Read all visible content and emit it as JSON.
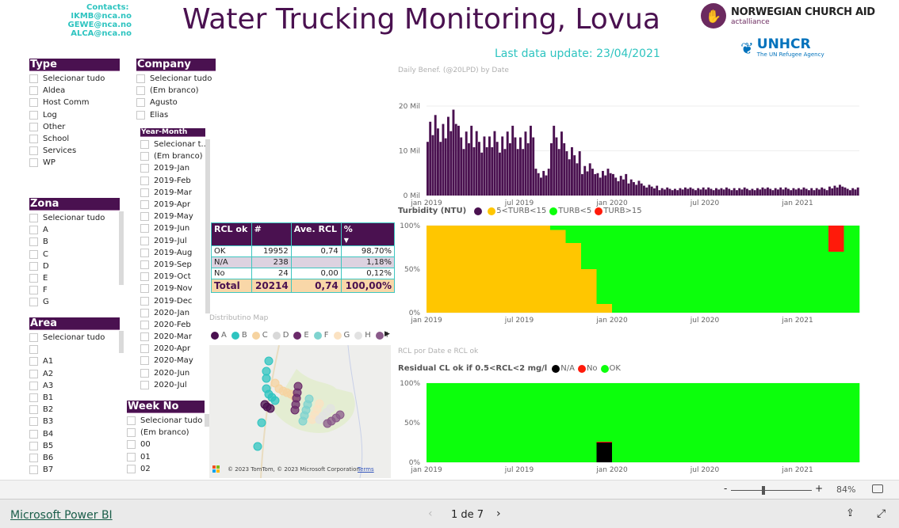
{
  "header": {
    "contacts_label": "Contacts:",
    "contacts": [
      "IKMB@nca.no",
      "GEWE@nca.no",
      "ALCA@nca.no"
    ],
    "title": "Water Trucking Monitoring, Lovua",
    "last_update": "Last data update: 23/04/2021",
    "logo_nca": "NORWEGIAN CHURCH AID",
    "logo_nca_sub": "actalliance",
    "logo_unhcr": "UNHCR",
    "logo_unhcr_sub": "The UN Refugee Agency"
  },
  "slicers": {
    "type": {
      "title": "Type",
      "items": [
        "Selecionar tudo",
        "Aldea",
        "Host Comm",
        "Log",
        "Other",
        "School",
        "Services",
        "WP"
      ]
    },
    "company": {
      "title": "Company",
      "items": [
        "Selecionar tudo",
        "(Em branco)",
        "Agusto",
        "Elias"
      ]
    },
    "year_month": {
      "title": "Year-Month",
      "items": [
        "Selecionar t...",
        "(Em branco)",
        "2019-Jan",
        "2019-Feb",
        "2019-Mar",
        "2019-Apr",
        "2019-May",
        "2019-Jun",
        "2019-Jul",
        "2019-Aug",
        "2019-Sep",
        "2019-Oct",
        "2019-Nov",
        "2019-Dec",
        "2020-Jan",
        "2020-Feb",
        "2020-Mar",
        "2020-Apr",
        "2020-May",
        "2020-Jun",
        "2020-Jul"
      ]
    },
    "zona": {
      "title": "Zona",
      "items": [
        "Selecionar tudo",
        "A",
        "B",
        "C",
        "D",
        "E",
        "F",
        "G"
      ]
    },
    "area": {
      "title": "Area",
      "items": [
        "Selecionar tudo",
        "",
        "A1",
        "A2",
        "A3",
        "B1",
        "B2",
        "B3",
        "B4",
        "B5",
        "B6",
        "B7"
      ]
    },
    "week": {
      "title": "Week No",
      "items": [
        "Selecionar tudo",
        "(Em branco)",
        "00",
        "01",
        "02"
      ]
    }
  },
  "rcl_table": {
    "headers": [
      "RCL ok",
      "#",
      "Ave. RCL",
      "%"
    ],
    "rows": [
      [
        "OK",
        "19952",
        "0,74",
        "98,70%"
      ],
      [
        "N/A",
        "238",
        "",
        "1,18%"
      ],
      [
        "No",
        "24",
        "0,00",
        "0,12%"
      ]
    ],
    "total": [
      "Total",
      "20214",
      "0,74",
      "100,00%"
    ]
  },
  "map": {
    "title": "Distributino Map",
    "legend": [
      {
        "label": "A",
        "color": "#4a1150"
      },
      {
        "label": "B",
        "color": "#2ec4c0"
      },
      {
        "label": "C",
        "color": "#f6d3a0"
      },
      {
        "label": "D",
        "color": "#d8d8d8"
      },
      {
        "label": "E",
        "color": "#6b2a6a"
      },
      {
        "label": "F",
        "color": "#7fd3cf"
      },
      {
        "label": "G",
        "color": "#fbe2c2"
      },
      {
        "label": "H",
        "color": "#e2e2e2"
      },
      {
        "label": "I",
        "color": "#8a5a8a"
      }
    ],
    "attribution": "© 2023 TomTom, © 2023 Microsoft Corporation",
    "terms": "Terms"
  },
  "chart_data": [
    {
      "type": "bar",
      "title": "Daily Benef. (@20LPD) by Date",
      "ylabel": "",
      "yticks": [
        "0 Mil",
        "10 Mil",
        "20 Mil"
      ],
      "ylim": [
        0,
        25
      ],
      "unit": "Mil",
      "xticks": [
        "jan 2019",
        "jul 2019",
        "jan 2020",
        "jul 2020",
        "jan 2021"
      ],
      "color": "#4a1150",
      "categories": [
        "2019-01",
        "2019-02",
        "2019-03",
        "2019-04",
        "2019-05",
        "2019-06",
        "2019-07",
        "2019-08",
        "2019-09",
        "2019-10",
        "2019-11",
        "2019-12",
        "2020-01",
        "2020-02",
        "2020-03",
        "2020-04",
        "2020-05",
        "2020-06",
        "2020-07",
        "2020-08",
        "2020-09",
        "2020-10",
        "2020-11",
        "2020-12",
        "2021-01",
        "2021-02",
        "2021-03",
        "2021-04"
      ],
      "values": [
        15,
        16,
        13,
        12,
        12,
        13,
        13,
        5,
        13,
        9,
        6,
        5,
        4,
        3,
        2,
        1.5,
        1.5,
        1.5,
        1.5,
        1.5,
        1.5,
        1.5,
        1.5,
        1.5,
        1.5,
        1.5,
        2,
        1.5
      ]
    },
    {
      "type": "bar",
      "stacked": "percent",
      "title": "Turbidity (NTU)",
      "yticks": [
        "0%",
        "50%",
        "100%"
      ],
      "xticks": [
        "jan 2019",
        "jul 2019",
        "jan 2020",
        "jul 2020",
        "jan 2021"
      ],
      "categories": [
        "2019-01",
        "2019-02",
        "2019-03",
        "2019-04",
        "2019-05",
        "2019-06",
        "2019-07",
        "2019-08",
        "2019-09",
        "2019-10",
        "2019-11",
        "2019-12",
        "2020-01",
        "2020-02",
        "2020-03",
        "2020-04",
        "2020-05",
        "2020-06",
        "2020-07",
        "2020-08",
        "2020-09",
        "2020-10",
        "2020-11",
        "2020-12",
        "2021-01",
        "2021-02",
        "2021-03",
        "2021-04"
      ],
      "series": [
        {
          "name": "5<TURB<15",
          "color": "#ffc600",
          "values": [
            100,
            100,
            100,
            100,
            100,
            100,
            100,
            100,
            95,
            80,
            50,
            10,
            0,
            0,
            0,
            0,
            0,
            0,
            0,
            0,
            0,
            0,
            0,
            0,
            0,
            0,
            0,
            0
          ]
        },
        {
          "name": "TURB<5",
          "color": "#0cff0c",
          "values": [
            0,
            0,
            0,
            0,
            0,
            0,
            0,
            0,
            5,
            20,
            50,
            90,
            100,
            100,
            100,
            100,
            100,
            100,
            100,
            100,
            100,
            100,
            100,
            100,
            100,
            100,
            70,
            100
          ]
        },
        {
          "name": "TURB>15",
          "color": "#ff1a0a",
          "values": [
            0,
            0,
            0,
            0,
            0,
            0,
            0,
            0,
            0,
            0,
            0,
            0,
            0,
            0,
            0,
            0,
            0,
            0,
            0,
            0,
            0,
            0,
            0,
            0,
            0,
            0,
            30,
            0
          ]
        }
      ],
      "legend_extra_color": "#4a1150"
    },
    {
      "type": "bar",
      "stacked": "percent",
      "title": "RCL por Date e RCL ok",
      "legend_title": "Residual CL ok if 0.5<RCL<2 mg/l",
      "yticks": [
        "0%",
        "50%",
        "100%"
      ],
      "xticks": [
        "jan 2019",
        "jul 2019",
        "jan 2020",
        "jul 2020",
        "jan 2021"
      ],
      "categories": [
        "2019-01",
        "2019-02",
        "2019-03",
        "2019-04",
        "2019-05",
        "2019-06",
        "2019-07",
        "2019-08",
        "2019-09",
        "2019-10",
        "2019-11",
        "2019-12",
        "2020-01",
        "2020-02",
        "2020-03",
        "2020-04",
        "2020-05",
        "2020-06",
        "2020-07",
        "2020-08",
        "2020-09",
        "2020-10",
        "2020-11",
        "2020-12",
        "2021-01",
        "2021-02",
        "2021-03",
        "2021-04"
      ],
      "series": [
        {
          "name": "N/A",
          "color": "#000000",
          "values": [
            0,
            0,
            0,
            0,
            0,
            0,
            0,
            0,
            0,
            0,
            0,
            25,
            0,
            0,
            0,
            0,
            0,
            0,
            0,
            0,
            0,
            0,
            0,
            0,
            0,
            0,
            0,
            0
          ]
        },
        {
          "name": "No",
          "color": "#ff1a0a",
          "values": [
            0,
            0,
            0,
            0,
            0,
            0,
            0,
            0,
            0,
            0,
            0,
            1,
            0,
            0,
            0,
            0,
            0,
            0,
            0,
            0,
            0,
            0,
            0,
            0,
            0,
            0,
            0,
            0
          ]
        },
        {
          "name": "OK",
          "color": "#0cff0c",
          "values": [
            100,
            100,
            100,
            100,
            100,
            100,
            100,
            100,
            100,
            100,
            100,
            74,
            100,
            100,
            100,
            100,
            100,
            100,
            100,
            100,
            100,
            100,
            100,
            100,
            100,
            100,
            100,
            100
          ]
        }
      ]
    }
  ],
  "zoom": {
    "minus": "-",
    "plus": "+",
    "level": "84%",
    "value": 84
  },
  "footer": {
    "brand": "Microsoft Power BI",
    "page": "1 de 7"
  }
}
